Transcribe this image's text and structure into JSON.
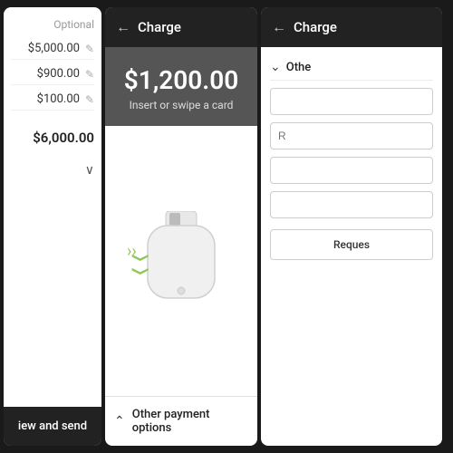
{
  "left_panel": {
    "optional_label": "Optional",
    "line_items": [
      {
        "amount": "$5,000.00"
      },
      {
        "amount": "$900.00"
      },
      {
        "amount": "$100.00"
      }
    ],
    "total": "$6,000.00",
    "bottom_button": "iew and send"
  },
  "middle_panel": {
    "header_title": "Charge",
    "back_label": "‹",
    "charge_amount": "$1,200.00",
    "charge_subtitle": "Insert or swipe a card",
    "other_payment": "Other payment options"
  },
  "right_panel": {
    "header_title": "Charge",
    "back_label": "‹",
    "other_label": "Othe",
    "input1_placeholder": "",
    "input2_placeholder": "R",
    "input3_placeholder": "",
    "input4_placeholder": "",
    "request_button": "Reques"
  }
}
